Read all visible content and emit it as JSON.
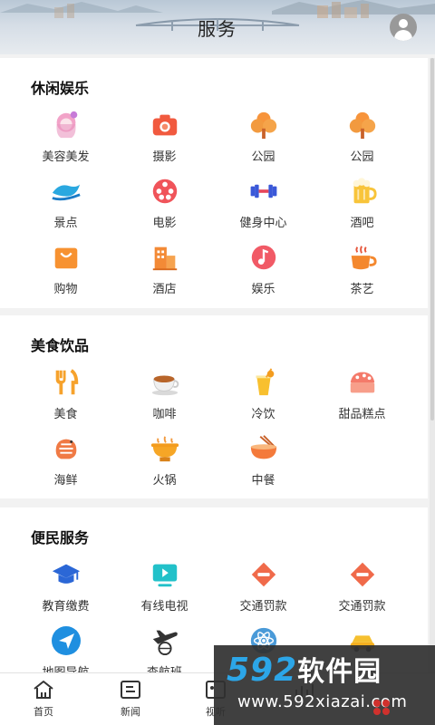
{
  "header": {
    "title": "服务"
  },
  "sections": [
    {
      "title": "休闲娱乐",
      "items": [
        {
          "label": "美容美发",
          "icon": "beauty-icon"
        },
        {
          "label": "摄影",
          "icon": "camera-icon"
        },
        {
          "label": "公园",
          "icon": "tree-icon"
        },
        {
          "label": "公园",
          "icon": "tree-icon"
        },
        {
          "label": "景点",
          "icon": "wave-icon"
        },
        {
          "label": "电影",
          "icon": "film-reel-icon"
        },
        {
          "label": "健身中心",
          "icon": "dumbbell-icon"
        },
        {
          "label": "酒吧",
          "icon": "beer-icon"
        },
        {
          "label": "购物",
          "icon": "shopping-bag-icon"
        },
        {
          "label": "酒店",
          "icon": "hotel-icon"
        },
        {
          "label": "娱乐",
          "icon": "music-icon"
        },
        {
          "label": "茶艺",
          "icon": "tea-cup-icon"
        }
      ]
    },
    {
      "title": "美食饮品",
      "items": [
        {
          "label": "美食",
          "icon": "fork-knife-icon"
        },
        {
          "label": "咖啡",
          "icon": "coffee-icon"
        },
        {
          "label": "冷饮",
          "icon": "cold-drink-icon"
        },
        {
          "label": "甜品糕点",
          "icon": "cake-icon"
        },
        {
          "label": "海鲜",
          "icon": "shrimp-icon"
        },
        {
          "label": "火锅",
          "icon": "hotpot-icon"
        },
        {
          "label": "中餐",
          "icon": "noodle-bowl-icon"
        }
      ]
    },
    {
      "title": "便民服务",
      "items": [
        {
          "label": "教育缴费",
          "icon": "graduation-cap-icon"
        },
        {
          "label": "有线电视",
          "icon": "tv-icon"
        },
        {
          "label": "交通罚款",
          "icon": "no-entry-icon"
        },
        {
          "label": "交通罚款",
          "icon": "no-entry-icon"
        },
        {
          "label": "地图导航",
          "icon": "navigation-arrow-icon"
        },
        {
          "label": "查航班",
          "icon": "airplane-icon"
        },
        {
          "label": "",
          "icon": "atom-icon"
        },
        {
          "label": "",
          "icon": "car-icon"
        }
      ]
    }
  ],
  "nav": [
    {
      "label": "首页",
      "icon": "home-icon"
    },
    {
      "label": "新闻",
      "icon": "news-icon"
    },
    {
      "label": "视听",
      "icon": "media-icon"
    },
    {
      "label": "",
      "icon": "more-icon"
    }
  ],
  "watermark": {
    "logo_num": "592",
    "logo_text": "软件园",
    "url": "www.592xiazai.com"
  }
}
